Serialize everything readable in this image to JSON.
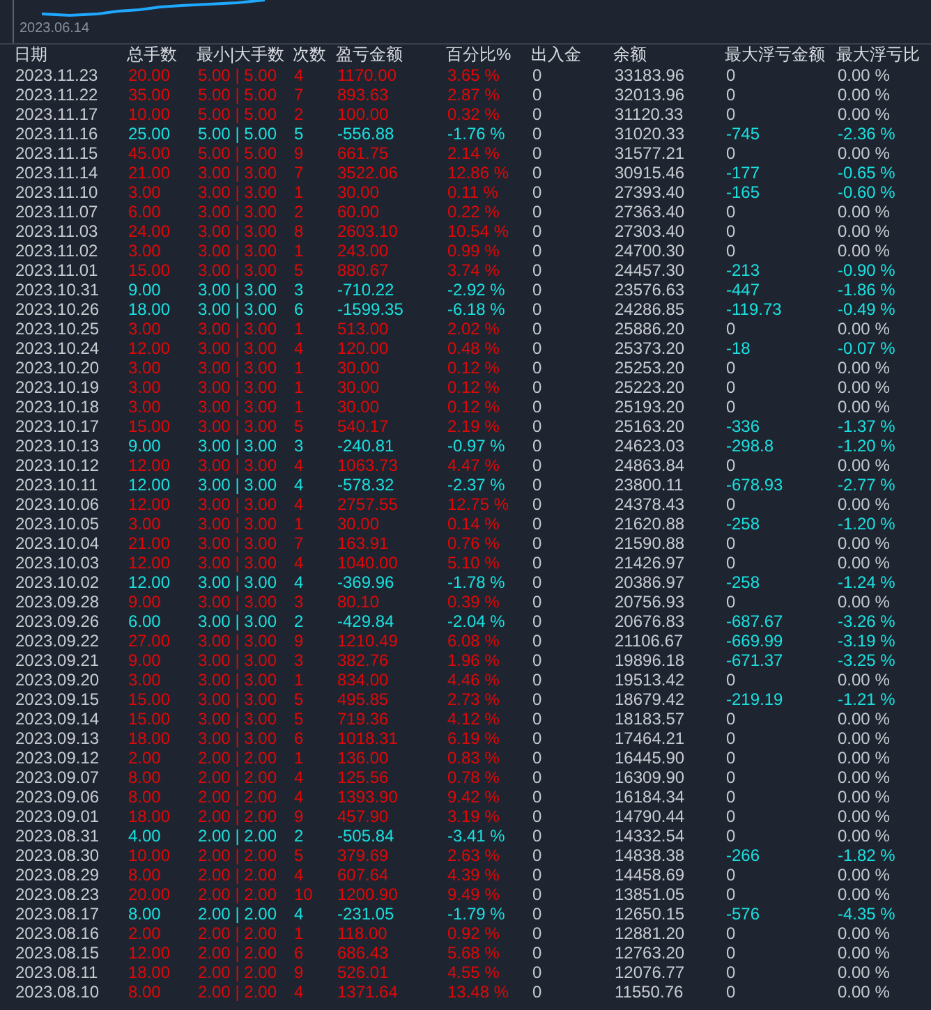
{
  "chart": {
    "date_label": "2023.06.14"
  },
  "table": {
    "columns": [
      "日期",
      "总手数",
      "最小|大手数",
      "次数",
      "盈亏金额",
      "百分比%",
      "出入金",
      "余额",
      "最大浮亏金额",
      "最大浮亏比"
    ],
    "rows": [
      {
        "kind": "profit",
        "drawdown": false,
        "cells": [
          "2023.11.23",
          "20.00",
          "5.00 | 5.00",
          "4",
          "1170.00",
          "3.65 %",
          "0",
          "33183.96",
          "0",
          "0.00 %"
        ]
      },
      {
        "kind": "profit",
        "drawdown": false,
        "cells": [
          "2023.11.22",
          "35.00",
          "5.00 | 5.00",
          "7",
          "893.63",
          "2.87 %",
          "0",
          "32013.96",
          "0",
          "0.00 %"
        ]
      },
      {
        "kind": "profit",
        "drawdown": false,
        "cells": [
          "2023.11.17",
          "10.00",
          "5.00 | 5.00",
          "2",
          "100.00",
          "0.32 %",
          "0",
          "31120.33",
          "0",
          "0.00 %"
        ]
      },
      {
        "kind": "loss",
        "drawdown": true,
        "cells": [
          "2023.11.16",
          "25.00",
          "5.00 | 5.00",
          "5",
          "-556.88",
          "-1.76 %",
          "0",
          "31020.33",
          "-745",
          "-2.36 %"
        ]
      },
      {
        "kind": "profit",
        "drawdown": false,
        "cells": [
          "2023.11.15",
          "45.00",
          "5.00 | 5.00",
          "9",
          "661.75",
          "2.14 %",
          "0",
          "31577.21",
          "0",
          "0.00 %"
        ]
      },
      {
        "kind": "profit",
        "drawdown": true,
        "cells": [
          "2023.11.14",
          "21.00",
          "3.00 | 3.00",
          "7",
          "3522.06",
          "12.86 %",
          "0",
          "30915.46",
          "-177",
          "-0.65 %"
        ]
      },
      {
        "kind": "profit",
        "drawdown": true,
        "cells": [
          "2023.11.10",
          "3.00",
          "3.00 | 3.00",
          "1",
          "30.00",
          "0.11 %",
          "0",
          "27393.40",
          "-165",
          "-0.60 %"
        ]
      },
      {
        "kind": "profit",
        "drawdown": false,
        "cells": [
          "2023.11.07",
          "6.00",
          "3.00 | 3.00",
          "2",
          "60.00",
          "0.22 %",
          "0",
          "27363.40",
          "0",
          "0.00 %"
        ]
      },
      {
        "kind": "profit",
        "drawdown": false,
        "cells": [
          "2023.11.03",
          "24.00",
          "3.00 | 3.00",
          "8",
          "2603.10",
          "10.54 %",
          "0",
          "27303.40",
          "0",
          "0.00 %"
        ]
      },
      {
        "kind": "profit",
        "drawdown": false,
        "cells": [
          "2023.11.02",
          "3.00",
          "3.00 | 3.00",
          "1",
          "243.00",
          "0.99 %",
          "0",
          "24700.30",
          "0",
          "0.00 %"
        ]
      },
      {
        "kind": "profit",
        "drawdown": true,
        "cells": [
          "2023.11.01",
          "15.00",
          "3.00 | 3.00",
          "5",
          "880.67",
          "3.74 %",
          "0",
          "24457.30",
          "-213",
          "-0.90 %"
        ]
      },
      {
        "kind": "loss",
        "drawdown": true,
        "cells": [
          "2023.10.31",
          "9.00",
          "3.00 | 3.00",
          "3",
          "-710.22",
          "-2.92 %",
          "0",
          "23576.63",
          "-447",
          "-1.86 %"
        ]
      },
      {
        "kind": "loss",
        "drawdown": true,
        "cells": [
          "2023.10.26",
          "18.00",
          "3.00 | 3.00",
          "6",
          "-1599.35",
          "-6.18 %",
          "0",
          "24286.85",
          "-119.73",
          "-0.49 %"
        ]
      },
      {
        "kind": "profit",
        "drawdown": false,
        "cells": [
          "2023.10.25",
          "3.00",
          "3.00 | 3.00",
          "1",
          "513.00",
          "2.02 %",
          "0",
          "25886.20",
          "0",
          "0.00 %"
        ]
      },
      {
        "kind": "profit",
        "drawdown": true,
        "cells": [
          "2023.10.24",
          "12.00",
          "3.00 | 3.00",
          "4",
          "120.00",
          "0.48 %",
          "0",
          "25373.20",
          "-18",
          "-0.07 %"
        ]
      },
      {
        "kind": "profit",
        "drawdown": false,
        "cells": [
          "2023.10.20",
          "3.00",
          "3.00 | 3.00",
          "1",
          "30.00",
          "0.12 %",
          "0",
          "25253.20",
          "0",
          "0.00 %"
        ]
      },
      {
        "kind": "profit",
        "drawdown": false,
        "cells": [
          "2023.10.19",
          "3.00",
          "3.00 | 3.00",
          "1",
          "30.00",
          "0.12 %",
          "0",
          "25223.20",
          "0",
          "0.00 %"
        ]
      },
      {
        "kind": "profit",
        "drawdown": false,
        "cells": [
          "2023.10.18",
          "3.00",
          "3.00 | 3.00",
          "1",
          "30.00",
          "0.12 %",
          "0",
          "25193.20",
          "0",
          "0.00 %"
        ]
      },
      {
        "kind": "profit",
        "drawdown": true,
        "cells": [
          "2023.10.17",
          "15.00",
          "3.00 | 3.00",
          "5",
          "540.17",
          "2.19 %",
          "0",
          "25163.20",
          "-336",
          "-1.37 %"
        ]
      },
      {
        "kind": "loss",
        "drawdown": true,
        "cells": [
          "2023.10.13",
          "9.00",
          "3.00 | 3.00",
          "3",
          "-240.81",
          "-0.97 %",
          "0",
          "24623.03",
          "-298.8",
          "-1.20 %"
        ]
      },
      {
        "kind": "profit",
        "drawdown": false,
        "cells": [
          "2023.10.12",
          "12.00",
          "3.00 | 3.00",
          "4",
          "1063.73",
          "4.47 %",
          "0",
          "24863.84",
          "0",
          "0.00 %"
        ]
      },
      {
        "kind": "loss",
        "drawdown": true,
        "cells": [
          "2023.10.11",
          "12.00",
          "3.00 | 3.00",
          "4",
          "-578.32",
          "-2.37 %",
          "0",
          "23800.11",
          "-678.93",
          "-2.77 %"
        ]
      },
      {
        "kind": "profit",
        "drawdown": false,
        "cells": [
          "2023.10.06",
          "12.00",
          "3.00 | 3.00",
          "4",
          "2757.55",
          "12.75 %",
          "0",
          "24378.43",
          "0",
          "0.00 %"
        ]
      },
      {
        "kind": "profit",
        "drawdown": true,
        "cells": [
          "2023.10.05",
          "3.00",
          "3.00 | 3.00",
          "1",
          "30.00",
          "0.14 %",
          "0",
          "21620.88",
          "-258",
          "-1.20 %"
        ]
      },
      {
        "kind": "profit",
        "drawdown": false,
        "cells": [
          "2023.10.04",
          "21.00",
          "3.00 | 3.00",
          "7",
          "163.91",
          "0.76 %",
          "0",
          "21590.88",
          "0",
          "0.00 %"
        ]
      },
      {
        "kind": "profit",
        "drawdown": false,
        "cells": [
          "2023.10.03",
          "12.00",
          "3.00 | 3.00",
          "4",
          "1040.00",
          "5.10 %",
          "0",
          "21426.97",
          "0",
          "0.00 %"
        ]
      },
      {
        "kind": "loss",
        "drawdown": true,
        "cells": [
          "2023.10.02",
          "12.00",
          "3.00 | 3.00",
          "4",
          "-369.96",
          "-1.78 %",
          "0",
          "20386.97",
          "-258",
          "-1.24 %"
        ]
      },
      {
        "kind": "profit",
        "drawdown": false,
        "cells": [
          "2023.09.28",
          "9.00",
          "3.00 | 3.00",
          "3",
          "80.10",
          "0.39 %",
          "0",
          "20756.93",
          "0",
          "0.00 %"
        ]
      },
      {
        "kind": "loss",
        "drawdown": true,
        "cells": [
          "2023.09.26",
          "6.00",
          "3.00 | 3.00",
          "2",
          "-429.84",
          "-2.04 %",
          "0",
          "20676.83",
          "-687.67",
          "-3.26 %"
        ]
      },
      {
        "kind": "profit",
        "drawdown": true,
        "cells": [
          "2023.09.22",
          "27.00",
          "3.00 | 3.00",
          "9",
          "1210.49",
          "6.08 %",
          "0",
          "21106.67",
          "-669.99",
          "-3.19 %"
        ]
      },
      {
        "kind": "profit",
        "drawdown": true,
        "cells": [
          "2023.09.21",
          "9.00",
          "3.00 | 3.00",
          "3",
          "382.76",
          "1.96 %",
          "0",
          "19896.18",
          "-671.37",
          "-3.25 %"
        ]
      },
      {
        "kind": "profit",
        "drawdown": false,
        "cells": [
          "2023.09.20",
          "3.00",
          "3.00 | 3.00",
          "1",
          "834.00",
          "4.46 %",
          "0",
          "19513.42",
          "0",
          "0.00 %"
        ]
      },
      {
        "kind": "profit",
        "drawdown": true,
        "cells": [
          "2023.09.15",
          "15.00",
          "3.00 | 3.00",
          "5",
          "495.85",
          "2.73 %",
          "0",
          "18679.42",
          "-219.19",
          "-1.21 %"
        ]
      },
      {
        "kind": "profit",
        "drawdown": false,
        "cells": [
          "2023.09.14",
          "15.00",
          "3.00 | 3.00",
          "5",
          "719.36",
          "4.12 %",
          "0",
          "18183.57",
          "0",
          "0.00 %"
        ]
      },
      {
        "kind": "profit",
        "drawdown": false,
        "cells": [
          "2023.09.13",
          "18.00",
          "3.00 | 3.00",
          "6",
          "1018.31",
          "6.19 %",
          "0",
          "17464.21",
          "0",
          "0.00 %"
        ]
      },
      {
        "kind": "profit",
        "drawdown": false,
        "cells": [
          "2023.09.12",
          "2.00",
          "2.00 | 2.00",
          "1",
          "136.00",
          "0.83 %",
          "0",
          "16445.90",
          "0",
          "0.00 %"
        ]
      },
      {
        "kind": "profit",
        "drawdown": false,
        "cells": [
          "2023.09.07",
          "8.00",
          "2.00 | 2.00",
          "4",
          "125.56",
          "0.78 %",
          "0",
          "16309.90",
          "0",
          "0.00 %"
        ]
      },
      {
        "kind": "profit",
        "drawdown": false,
        "cells": [
          "2023.09.06",
          "8.00",
          "2.00 | 2.00",
          "4",
          "1393.90",
          "9.42 %",
          "0",
          "16184.34",
          "0",
          "0.00 %"
        ]
      },
      {
        "kind": "profit",
        "drawdown": false,
        "cells": [
          "2023.09.01",
          "18.00",
          "2.00 | 2.00",
          "9",
          "457.90",
          "3.19 %",
          "0",
          "14790.44",
          "0",
          "0.00 %"
        ]
      },
      {
        "kind": "loss",
        "drawdown": false,
        "cells": [
          "2023.08.31",
          "4.00",
          "2.00 | 2.00",
          "2",
          "-505.84",
          "-3.41 %",
          "0",
          "14332.54",
          "0",
          "0.00 %"
        ]
      },
      {
        "kind": "profit",
        "drawdown": true,
        "cells": [
          "2023.08.30",
          "10.00",
          "2.00 | 2.00",
          "5",
          "379.69",
          "2.63 %",
          "0",
          "14838.38",
          "-266",
          "-1.82 %"
        ]
      },
      {
        "kind": "profit",
        "drawdown": false,
        "cells": [
          "2023.08.29",
          "8.00",
          "2.00 | 2.00",
          "4",
          "607.64",
          "4.39 %",
          "0",
          "14458.69",
          "0",
          "0.00 %"
        ]
      },
      {
        "kind": "profit",
        "drawdown": false,
        "cells": [
          "2023.08.23",
          "20.00",
          "2.00 | 2.00",
          "10",
          "1200.90",
          "9.49 %",
          "0",
          "13851.05",
          "0",
          "0.00 %"
        ]
      },
      {
        "kind": "loss",
        "drawdown": true,
        "cells": [
          "2023.08.17",
          "8.00",
          "2.00 | 2.00",
          "4",
          "-231.05",
          "-1.79 %",
          "0",
          "12650.15",
          "-576",
          "-4.35 %"
        ]
      },
      {
        "kind": "profit",
        "drawdown": false,
        "cells": [
          "2023.08.16",
          "2.00",
          "2.00 | 2.00",
          "1",
          "118.00",
          "0.92 %",
          "0",
          "12881.20",
          "0",
          "0.00 %"
        ]
      },
      {
        "kind": "profit",
        "drawdown": false,
        "cells": [
          "2023.08.15",
          "12.00",
          "2.00 | 2.00",
          "6",
          "686.43",
          "5.68 %",
          "0",
          "12763.20",
          "0",
          "0.00 %"
        ]
      },
      {
        "kind": "profit",
        "drawdown": false,
        "cells": [
          "2023.08.11",
          "18.00",
          "2.00 | 2.00",
          "9",
          "526.01",
          "4.55 %",
          "0",
          "12076.77",
          "0",
          "0.00 %"
        ]
      },
      {
        "kind": "profit",
        "drawdown": false,
        "cells": [
          "2023.08.10",
          "8.00",
          "2.00 | 2.00",
          "4",
          "1371.64",
          "13.48 %",
          "0",
          "11550.76",
          "0",
          "0.00 %"
        ]
      }
    ]
  }
}
